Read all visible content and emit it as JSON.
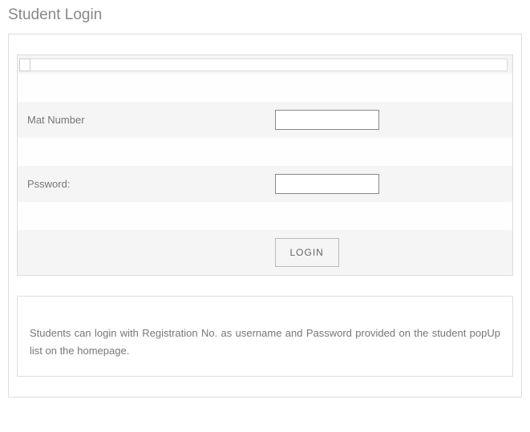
{
  "title": "Student Login",
  "form": {
    "mat_label": "Mat Number",
    "mat_value": "",
    "password_label": "Pssword:",
    "password_value": "",
    "login_button": "LOGIN"
  },
  "info_text": "Students can login with Registration No. as username and Password provided on the student popUp list on the homepage."
}
